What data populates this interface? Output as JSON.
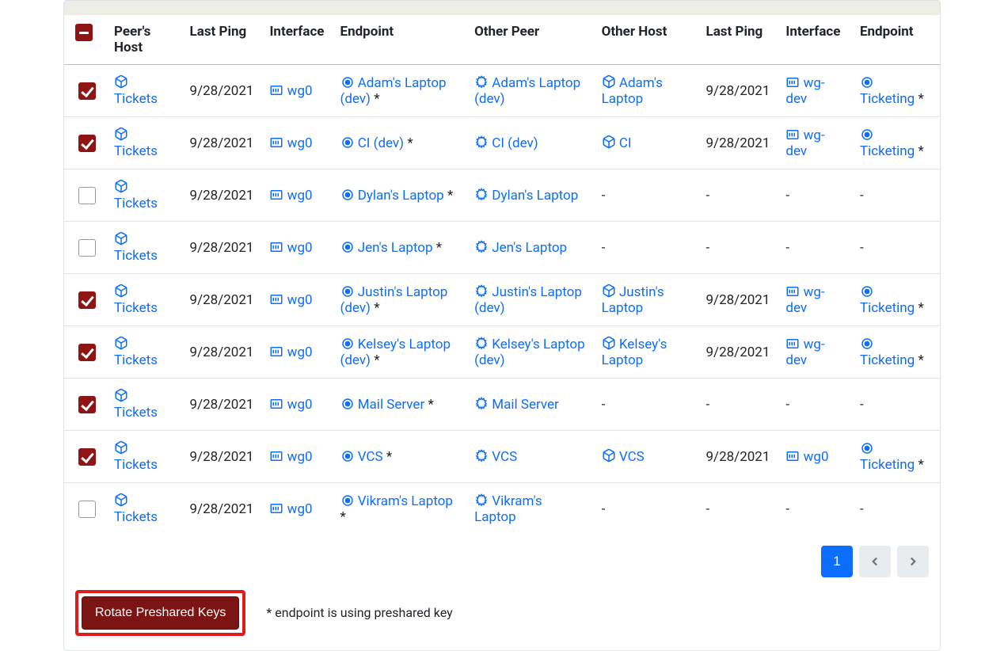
{
  "headers": {
    "select": "",
    "peers_host": "Peer's Host",
    "last_ping_1": "Last Ping",
    "interface_1": "Interface",
    "endpoint_1": "Endpoint",
    "other_peer": "Other Peer",
    "other_host": "Other Host",
    "last_ping_2": "Last Ping",
    "interface_2": "Interface",
    "endpoint_2": "Endpoint"
  },
  "interfaces": {
    "wg0": "wg0",
    "wg_dev": "wg-dev"
  },
  "hosts": {
    "tickets": "Tickets",
    "adams_laptop": "Adam's Laptop",
    "ci": "CI",
    "justins_laptop": "Justin's Laptop",
    "kelseys_laptop": "Kelsey's Laptop",
    "vcs": "VCS"
  },
  "rows": [
    {
      "checked": true,
      "host": "Tickets",
      "date": "9/28/2021",
      "iface": "wg0",
      "endpoint": "Adam's Laptop (dev)",
      "star": true,
      "other_peer": "Adam's Laptop (dev)",
      "other_host": "Adam's Laptop",
      "date2": "9/28/2021",
      "iface2": "wg-dev",
      "endpoint2": "Ticketing",
      "star2": true,
      "has_right": true
    },
    {
      "checked": true,
      "host": "Tickets",
      "date": "9/28/2021",
      "iface": "wg0",
      "endpoint": "CI (dev)",
      "star": true,
      "other_peer": "CI (dev)",
      "other_host": "CI",
      "date2": "9/28/2021",
      "iface2": "wg-dev",
      "endpoint2": "Ticketing",
      "star2": true,
      "has_right": true
    },
    {
      "checked": false,
      "host": "Tickets",
      "date": "9/28/2021",
      "iface": "wg0",
      "endpoint": "Dylan's Laptop",
      "star": true,
      "other_peer": "Dylan's Laptop",
      "other_host": "-",
      "date2": "-",
      "iface2": "-",
      "endpoint2": "-",
      "star2": false,
      "has_right": false
    },
    {
      "checked": false,
      "host": "Tickets",
      "date": "9/28/2021",
      "iface": "wg0",
      "endpoint": "Jen's Laptop",
      "star": true,
      "other_peer": "Jen's Laptop",
      "other_host": "-",
      "date2": "-",
      "iface2": "-",
      "endpoint2": "-",
      "star2": false,
      "has_right": false
    },
    {
      "checked": true,
      "host": "Tickets",
      "date": "9/28/2021",
      "iface": "wg0",
      "endpoint": "Justin's Laptop (dev)",
      "star": true,
      "other_peer": "Justin's Laptop (dev)",
      "other_host": "Justin's Laptop",
      "date2": "9/28/2021",
      "iface2": "wg-dev",
      "endpoint2": "Ticketing",
      "star2": true,
      "has_right": true
    },
    {
      "checked": true,
      "host": "Tickets",
      "date": "9/28/2021",
      "iface": "wg0",
      "endpoint": "Kelsey's Laptop (dev)",
      "star": true,
      "other_peer": "Kelsey's Laptop (dev)",
      "other_host": "Kelsey's Laptop",
      "date2": "9/28/2021",
      "iface2": "wg-dev",
      "endpoint2": "Ticketing",
      "star2": true,
      "has_right": true
    },
    {
      "checked": true,
      "host": "Tickets",
      "date": "9/28/2021",
      "iface": "wg0",
      "endpoint": "Mail Server",
      "star": true,
      "other_peer": "Mail Server",
      "other_host": "-",
      "date2": "-",
      "iface2": "-",
      "endpoint2": "-",
      "star2": false,
      "has_right": false
    },
    {
      "checked": true,
      "host": "Tickets",
      "date": "9/28/2021",
      "iface": "wg0",
      "endpoint": "VCS",
      "star": true,
      "other_peer": "VCS",
      "other_host": "VCS",
      "date2": "9/28/2021",
      "iface2": "wg0",
      "endpoint2": "Ticketing",
      "star2": true,
      "has_right": true
    },
    {
      "checked": false,
      "host": "Tickets",
      "date": "9/28/2021",
      "iface": "wg0",
      "endpoint": "Vikram's Laptop",
      "star": true,
      "other_peer": "Vikram's Laptop",
      "other_host": "-",
      "date2": "-",
      "iface2": "-",
      "endpoint2": "-",
      "star2": false,
      "has_right": false
    }
  ],
  "pagination": {
    "current": "1"
  },
  "buttons": {
    "rotate": "Rotate Preshared Keys"
  },
  "footnote": "* endpoint is using preshared key"
}
